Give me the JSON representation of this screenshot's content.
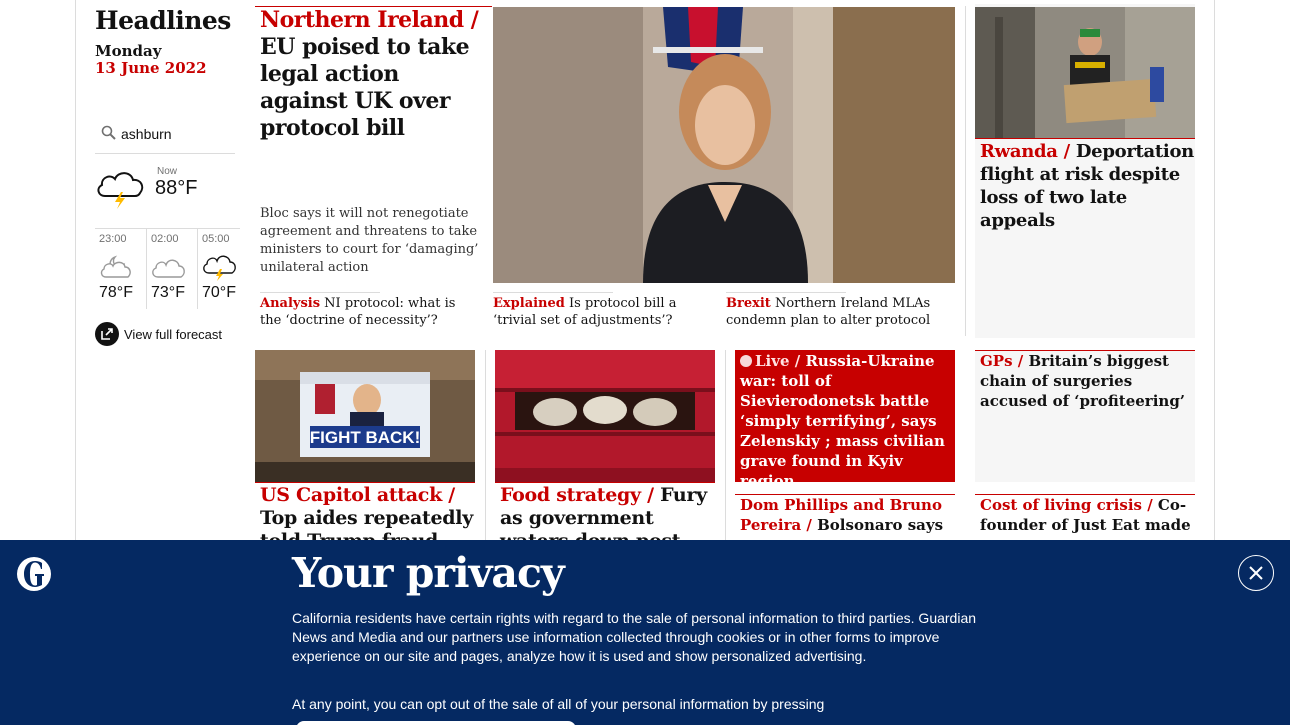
{
  "sidebar": {
    "title": "Headlines",
    "day": "Monday",
    "date": "13 June 2022",
    "search_value": "ashburn",
    "weather": {
      "now_label": "Now",
      "now_temp": "88°F",
      "now_icon": "thunder-cloud-icon",
      "forecast": [
        {
          "time": "23:00",
          "temp": "78°F",
          "icon": "partly-cloudy-night-icon"
        },
        {
          "time": "02:00",
          "temp": "73°F",
          "icon": "cloud-icon"
        },
        {
          "time": "05:00",
          "temp": "70°F",
          "icon": "thunder-cloud-icon"
        }
      ],
      "full_forecast_label": "View full forecast"
    }
  },
  "lead": {
    "kicker": "Northern Ireland /",
    "headline": "EU poised to take legal action against UK over protocol bill",
    "standfirst": "Bloc says it will not renegotiate agreement and threatens to take ministers to court for ‘damaging’ unilateral action",
    "subs": [
      {
        "kicker": "Analysis",
        "headline": "NI protocol: what is the ‘doctrine of necessity’?"
      },
      {
        "kicker": "Explained",
        "headline": "Is protocol bill a ‘trivial set of adjustments’?"
      },
      {
        "kicker": "Brexit",
        "headline": "Northern Ireland MLAs condemn plan to alter protocol"
      }
    ]
  },
  "rwanda": {
    "kicker": "Rwanda /",
    "headline": "Deportation flight at risk despite loss of two late appeals"
  },
  "row2": {
    "capitol": {
      "kicker": "US Capitol attack /",
      "headline": "Top aides repeatedly told Trump fraud"
    },
    "food": {
      "kicker": "Food strategy /",
      "headline": "Fury as government waters down post-Brexit food"
    },
    "live": {
      "kicker": "Live /",
      "headline": "Russia-Ukraine war: toll of Sievierodonetsk battle ‘simply terrifying’, says Zelenskiy ; mass civilian grave found in Kyiv region"
    },
    "gps": {
      "kicker": "GPs /",
      "headline": "Britain’s biggest chain of surgeries accused of ‘profiteering’"
    },
    "phillips": {
      "kicker": "Dom Phillips and Bruno Pereira /",
      "headline": "Bolsonaro says"
    },
    "cost": {
      "kicker": "Cost of living crisis /",
      "headline": "Co-founder of Just Eat made"
    }
  },
  "images": {
    "lead_sign": "FIGHT BACK!"
  },
  "privacy": {
    "title": "Your privacy",
    "body": "California residents have certain rights with regard to the sale of personal information to third parties. Guardian News and Media and our partners use information collected through cookies or in other forms to improve experience on our site and pages, analyze how it is used and show personalized advertising.",
    "body2": "At any point, you can opt out of the sale of all of your personal information by pressing"
  }
}
